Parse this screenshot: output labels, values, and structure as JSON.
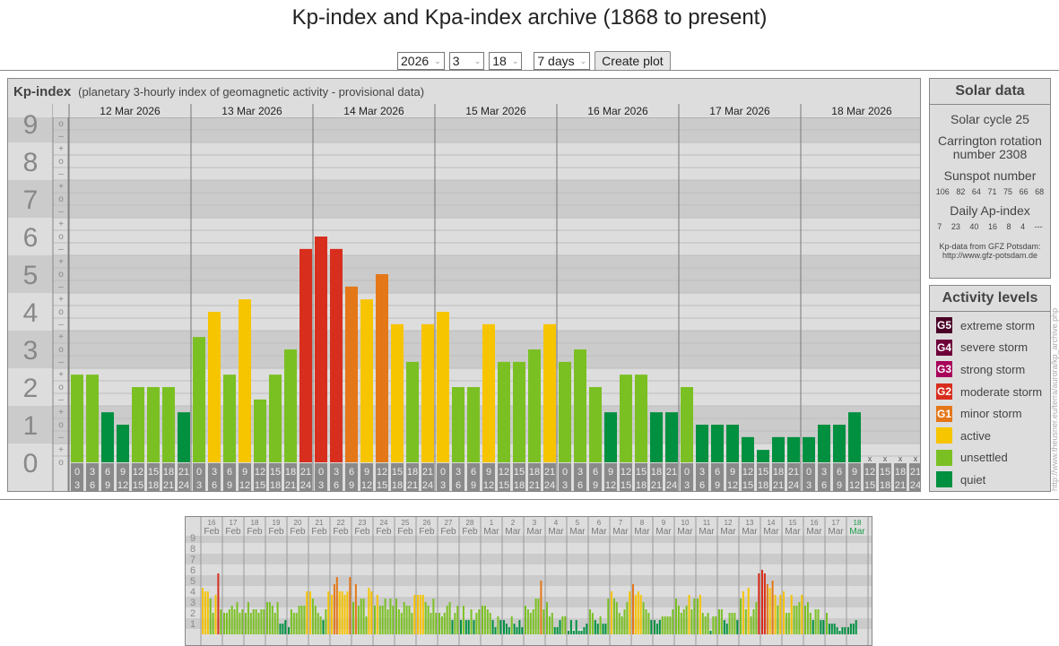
{
  "page_title": "Kp-index and Kpa-index archive (1868 to present)",
  "controls": {
    "year": "2026",
    "month": "3",
    "day": "18",
    "range": "7 days",
    "create_label": "Create plot"
  },
  "kp_panel": {
    "title": "Kp-index",
    "subtitle": "(planetary 3-hourly index of geomagnetic activity - provisional data)"
  },
  "solar": {
    "title": "Solar data",
    "cycle": "Solar cycle 25",
    "carrington": "Carrington rotation number 2308",
    "sunspot_label": "Sunspot number",
    "sunspot_values": [
      "106",
      "82",
      "64",
      "71",
      "75",
      "66",
      "68"
    ],
    "ap_label": "Daily Ap-index",
    "ap_values": [
      "7",
      "23",
      "40",
      "16",
      "8",
      "4",
      "---"
    ],
    "source_line1": "Kp-data from GFZ Potsdam:",
    "source_line2": "http://www.gfz-potsdam.de"
  },
  "levels": {
    "title": "Activity levels",
    "items": [
      {
        "code": "G5",
        "label": "extreme storm",
        "color": "#4a0026"
      },
      {
        "code": "G4",
        "label": "severe storm",
        "color": "#6e0039"
      },
      {
        "code": "G3",
        "label": "strong storm",
        "color": "#a8005a"
      },
      {
        "code": "G2",
        "label": "moderate storm",
        "color": "#d82e1e"
      },
      {
        "code": "G1",
        "label": "minor storm",
        "color": "#e47718"
      },
      {
        "code": "",
        "label": "active",
        "color": "#f7c400"
      },
      {
        "code": "",
        "label": "unsettled",
        "color": "#7bc023"
      },
      {
        "code": "",
        "label": "quiet",
        "color": "#009040"
      }
    ]
  },
  "watermark": "http://www.theusner.eu/terra/aurora/kp_archive.php",
  "chart_data": [
    {
      "type": "bar",
      "title": "Kp-index",
      "ylim": [
        0,
        9
      ],
      "yticks": [
        "0",
        "1",
        "2",
        "3",
        "4",
        "5",
        "6",
        "7",
        "8",
        "9"
      ],
      "slot_labels": [
        [
          "0",
          "3"
        ],
        [
          "3",
          "6"
        ],
        [
          "6",
          "9"
        ],
        [
          "9",
          "12"
        ],
        [
          "12",
          "15"
        ],
        [
          "15",
          "18"
        ],
        [
          "18",
          "21"
        ],
        [
          "21",
          "24"
        ]
      ],
      "missing_marker": "x",
      "days": [
        {
          "date": "12 Mar 2026",
          "values": [
            2.33,
            2.33,
            1.33,
            1,
            2,
            2,
            2,
            1.33
          ]
        },
        {
          "date": "13 Mar 2026",
          "values": [
            3.33,
            4,
            2.33,
            4.33,
            1.67,
            2.33,
            3,
            5.67
          ]
        },
        {
          "date": "14 Mar 2026",
          "values": [
            6,
            5.67,
            4.67,
            4.33,
            5,
            3.67,
            2.67,
            3.67
          ]
        },
        {
          "date": "15 Mar 2026",
          "values": [
            4,
            2,
            2,
            3.67,
            2.67,
            2.67,
            3,
            3.67
          ]
        },
        {
          "date": "16 Mar 2026",
          "values": [
            2.67,
            3,
            2,
            1.33,
            2.33,
            2.33,
            1.33,
            1.33
          ]
        },
        {
          "date": "17 Mar 2026",
          "values": [
            2,
            1,
            1,
            1,
            0.67,
            0.33,
            0.67,
            0.67
          ]
        },
        {
          "date": "18 Mar 2026",
          "values": [
            0.67,
            1,
            1,
            1.33,
            null,
            null,
            null,
            null
          ]
        }
      ]
    },
    {
      "type": "bar",
      "title": "Kp-index overview (31 days)",
      "ylim": [
        0,
        9
      ],
      "yticks": [
        "1",
        "2",
        "3",
        "4",
        "5",
        "6",
        "7",
        "8",
        "9"
      ],
      "days": [
        {
          "day": "16",
          "month": "Feb",
          "values": [
            4.33,
            4,
            4,
            3.33,
            2,
            3.67,
            5.67,
            2.33
          ]
        },
        {
          "day": "17",
          "month": "Feb",
          "values": [
            2,
            2,
            2.33,
            2.67,
            2.33,
            3,
            2,
            2.33
          ]
        },
        {
          "day": "18",
          "month": "Feb",
          "values": [
            2,
            3,
            2,
            2.33,
            2.33,
            2,
            2.33,
            2.33
          ]
        },
        {
          "day": "19",
          "month": "Feb",
          "values": [
            3,
            3,
            2.67,
            2,
            3,
            1,
            1,
            1.33
          ]
        },
        {
          "day": "20",
          "month": "Feb",
          "values": [
            0.67,
            2.33,
            2,
            2,
            2.67,
            2.67,
            2.67,
            4
          ]
        },
        {
          "day": "21",
          "month": "Feb",
          "values": [
            4,
            3.33,
            2.67,
            2,
            1.67,
            1.33,
            2.33,
            4
          ]
        },
        {
          "day": "22",
          "month": "Feb",
          "values": [
            3.67,
            4.67,
            5.33,
            4,
            4,
            3.67,
            4,
            5.33
          ]
        },
        {
          "day": "23",
          "month": "Feb",
          "values": [
            3,
            4.67,
            2.67,
            3.33,
            3.33,
            1.67,
            4.33,
            4
          ]
        },
        {
          "day": "24",
          "month": "Feb",
          "values": [
            2.67,
            3.67,
            2.67,
            2.67,
            3.33,
            2.33,
            3.33,
            2.67
          ]
        },
        {
          "day": "25",
          "month": "Feb",
          "values": [
            3.33,
            2.33,
            2,
            3,
            2.67,
            2.67,
            2,
            3.67
          ]
        },
        {
          "day": "26",
          "month": "Feb",
          "values": [
            3.67,
            3.67,
            3.67,
            3,
            2.67,
            2,
            3.33,
            2
          ]
        },
        {
          "day": "27",
          "month": "Feb",
          "values": [
            2,
            1.67,
            2,
            2.67,
            3,
            1.33,
            2,
            2.67
          ]
        },
        {
          "day": "28",
          "month": "Feb",
          "values": [
            1.33,
            2.67,
            1.33,
            1.33,
            2.33,
            1.33,
            2,
            2.33
          ]
        },
        {
          "day": "1",
          "month": "Mar",
          "values": [
            2.67,
            2.67,
            2.33,
            2,
            1.33,
            0.67,
            1.67,
            1.33
          ]
        },
        {
          "day": "2",
          "month": "Mar",
          "values": [
            1.33,
            1,
            0.67,
            1.67,
            1,
            0.67,
            1.33,
            0.67
          ]
        },
        {
          "day": "3",
          "month": "Mar",
          "values": [
            2.67,
            2.33,
            2,
            2.33,
            3.33,
            3.33,
            5,
            2.33
          ]
        },
        {
          "day": "4",
          "month": "Mar",
          "values": [
            3,
            1.67,
            2,
            0.67,
            0.67,
            1.33,
            1.67,
            1.67
          ]
        },
        {
          "day": "5",
          "month": "Mar",
          "values": [
            0.33,
            1.33,
            0.33,
            1.33,
            0.33,
            0.33,
            0.67,
            1
          ]
        },
        {
          "day": "6",
          "month": "Mar",
          "values": [
            2.33,
            2,
            1.33,
            1,
            1.67,
            1,
            1,
            3.33
          ]
        },
        {
          "day": "7",
          "month": "Mar",
          "values": [
            4,
            3.33,
            3,
            2,
            1.67,
            2.33,
            3,
            4
          ]
        },
        {
          "day": "8",
          "month": "Mar",
          "values": [
            4.67,
            3.67,
            4,
            3.67,
            3,
            2.33,
            2,
            1.33
          ]
        },
        {
          "day": "9",
          "month": "Mar",
          "values": [
            1.33,
            1,
            1.33,
            1.67,
            1.67,
            1.67,
            1.67,
            2.33
          ]
        },
        {
          "day": "10",
          "month": "Mar",
          "values": [
            3.33,
            2.67,
            2,
            2.33,
            2.67,
            3.67,
            2.33,
            3.33
          ]
        },
        {
          "day": "11",
          "month": "Mar",
          "values": [
            3.33,
            3.67,
            2,
            1.67,
            2,
            0.33,
            1.67,
            1.67
          ]
        },
        {
          "day": "12",
          "month": "Mar",
          "values": [
            2.33,
            2.33,
            1.33,
            1,
            2,
            2,
            2,
            1.33
          ]
        },
        {
          "day": "13",
          "month": "Mar",
          "values": [
            3.33,
            4,
            2.33,
            4.33,
            1.67,
            2.33,
            3,
            5.67
          ]
        },
        {
          "day": "14",
          "month": "Mar",
          "values": [
            6,
            5.67,
            4.67,
            4.33,
            5,
            3.67,
            2.67,
            3.67
          ]
        },
        {
          "day": "15",
          "month": "Mar",
          "values": [
            4,
            2,
            2,
            3.67,
            2.67,
            2.67,
            3,
            3.67
          ]
        },
        {
          "day": "16",
          "month": "Mar",
          "values": [
            2.67,
            3,
            2,
            1.33,
            2.33,
            2.33,
            1.33,
            1.33
          ]
        },
        {
          "day": "17",
          "month": "Mar",
          "values": [
            2,
            1,
            1,
            1,
            0.67,
            0.33,
            0.67,
            0.67
          ]
        },
        {
          "day": "18",
          "month": "Mar",
          "values": [
            0.67,
            1,
            1,
            1.33,
            null,
            null,
            null,
            null
          ],
          "current": true
        }
      ]
    }
  ]
}
